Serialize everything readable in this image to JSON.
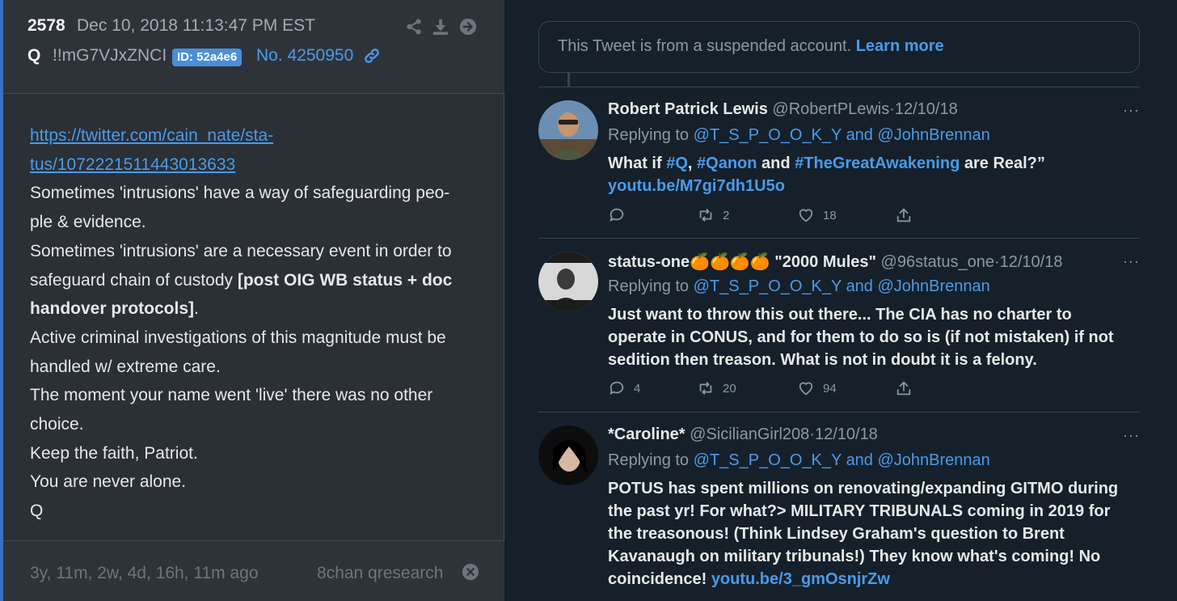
{
  "post": {
    "number": "2578",
    "date": "Dec 10, 2018 11:13:47 PM EST",
    "author": "Q",
    "tripcode": "!!mG7VJxZNCI",
    "id_badge": "ID: 52a4e6",
    "post_no": "No. 4250950",
    "link_lines": [
      "https://twitter.com/cain_nate/sta-",
      "tus/1072221511443013633"
    ],
    "body_lines": [
      "Sometimes 'intrusions' have a way of safeguarding peo-",
      "ple & evidence.",
      "Sometimes 'intrusions' are a necessary event in order to",
      "safeguard chain of custody ",
      "[post OIG WB status + doc",
      "handover protocols]",
      ".",
      "Active criminal investigations of this magnitude must be",
      "handled w/ extreme care.",
      "The moment your name went 'live' there was no other",
      "choice.",
      "Keep the faith, Patriot.",
      "You are never alone.",
      "Q"
    ],
    "ago": "3y, 11m, 2w, 4d, 16h, 11m ago",
    "source": "8chan qresearch"
  },
  "suspended": {
    "text": "This Tweet is from a suspended account.",
    "learn_more": "Learn more"
  },
  "tweets": [
    {
      "name": "Robert Patrick Lewis",
      "handle": "@RobertPLewis",
      "date": "·12/10/18",
      "replying_prefix": "Replying to",
      "reply_handle_1": "@T_S_P_O_O_K_Y",
      "reply_and": "and",
      "reply_handle_2": "@JohnBrennan",
      "text": {
        "p1": "What if ",
        "h1": "#Q",
        "p2": ", ",
        "h2": "#Qanon",
        "p3": " and ",
        "h3": "#TheGreatAwakening",
        "p4": " are Real?”",
        "link": "youtu.be/M7gi7dh1U5o"
      },
      "replies": "",
      "retweets": "2",
      "likes": "18"
    },
    {
      "name": "status-one🍊🍊🍊🍊 \"2000 Mules\"",
      "handle": "@96status_one",
      "date": "·12/10/18",
      "replying_prefix": "Replying to",
      "reply_handle_1": "@T_S_P_O_O_K_Y",
      "reply_and": "and",
      "reply_handle_2": "@JohnBrennan",
      "text_lines": [
        "Just want to throw this out there... The CIA has no charter to",
        "operate in CONUS, and for them to do so is (if not mistaken)  if not",
        "sedition then treason. What is not in doubt it is a felony."
      ],
      "replies": "4",
      "retweets": "20",
      "likes": "94"
    },
    {
      "name": "*Caroline*",
      "handle": "@SicilianGirl208",
      "date": "·12/10/18",
      "replying_prefix": "Replying to",
      "reply_handle_1": "@T_S_P_O_O_K_Y",
      "reply_and": "and",
      "reply_handle_2": "@JohnBrennan",
      "text_lines": [
        "POTUS has spent millions on renovating/expanding GITMO during",
        "the past yr! For what?> MILITARY TRIBUNALS coming in 2019 for",
        "the treasonous! (Think Lindsey Graham's question to Brent",
        "Kavanaugh on military tribunals!) They know what's coming! No",
        "coincidence! "
      ],
      "link": "youtu.be/3_gmOsnjrZw"
    }
  ],
  "more_label": "···",
  "colors": {
    "link_blue": "#4a9be8",
    "badge_blue": "#4a8fd9",
    "left_bg": "#2b2f36",
    "right_bg": "#15202b"
  }
}
